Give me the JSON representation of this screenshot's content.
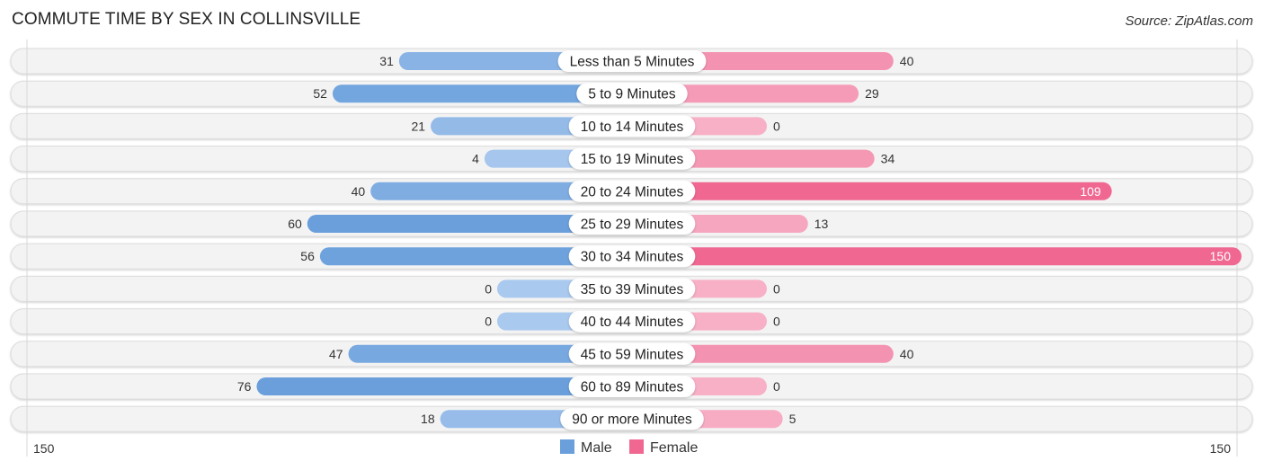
{
  "header": {
    "title": "COMMUTE TIME BY SEX IN COLLINSVILLE",
    "source": "Source: ZipAtlas.com"
  },
  "chart_data": {
    "type": "bar",
    "orientation": "horizontal-diverging",
    "title": "COMMUTE TIME BY SEX IN COLLINSVILLE",
    "categories": [
      "Less than 5 Minutes",
      "5 to 9 Minutes",
      "10 to 14 Minutes",
      "15 to 19 Minutes",
      "20 to 24 Minutes",
      "25 to 29 Minutes",
      "30 to 34 Minutes",
      "35 to 39 Minutes",
      "40 to 44 Minutes",
      "45 to 59 Minutes",
      "60 to 89 Minutes",
      "90 or more Minutes"
    ],
    "series": [
      {
        "name": "Male",
        "color": "#6a9fdc",
        "values": [
          31,
          52,
          21,
          4,
          40,
          60,
          56,
          0,
          0,
          47,
          76,
          18
        ]
      },
      {
        "name": "Female",
        "color": "#f06892",
        "values": [
          40,
          29,
          0,
          34,
          109,
          13,
          150,
          0,
          0,
          40,
          0,
          5
        ]
      }
    ],
    "axis": {
      "left_label": "150",
      "right_label": "150",
      "max": 150
    },
    "legend": {
      "position": "bottom-center",
      "entries": [
        "Male",
        "Female"
      ]
    },
    "xlabel": "",
    "ylabel": ""
  }
}
